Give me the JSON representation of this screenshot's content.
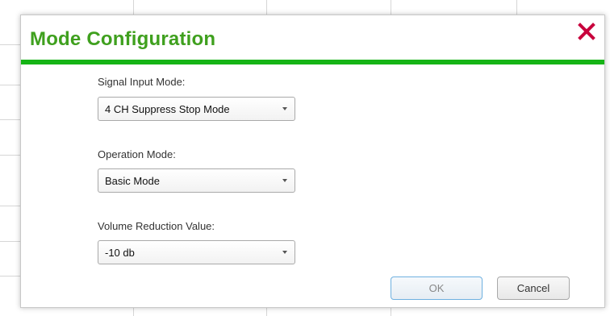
{
  "dialog": {
    "title": "Mode Configuration",
    "close_icon": "close-x-icon",
    "accent_color": "#3fa01e",
    "rule_color": "#16b416",
    "close_color": "#c8003c"
  },
  "fields": [
    {
      "label": "Signal Input Mode:",
      "value": "4 CH Suppress Stop Mode"
    },
    {
      "label": "Operation Mode:",
      "value": "Basic Mode"
    },
    {
      "label": "Volume Reduction Value:",
      "value": "-10 db"
    }
  ],
  "buttons": {
    "ok_label": "OK",
    "cancel_label": "Cancel"
  }
}
